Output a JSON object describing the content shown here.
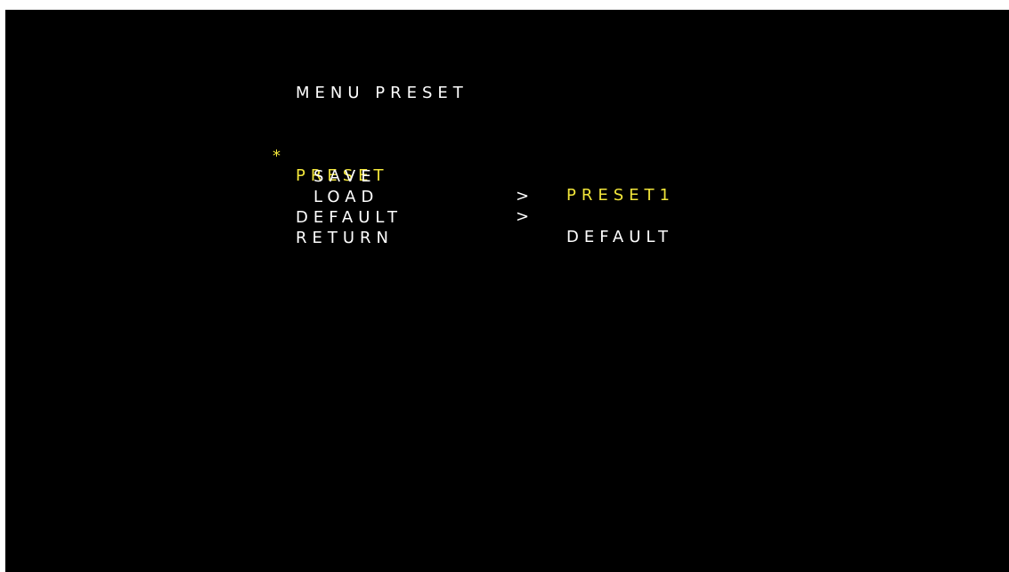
{
  "osd_menu": {
    "title": "MENU PRESET",
    "selection_marker": "*",
    "highlight_color": "#f2e63a",
    "text_color": "#ffffff",
    "background_color": "#000000",
    "items": [
      {
        "label": "PRESET",
        "arrow": "",
        "value": "PRESET1",
        "selected": true
      },
      {
        "label": "SAVE",
        "arrow": ">",
        "value": "",
        "selected": false
      },
      {
        "label": "LOAD",
        "arrow": ">",
        "value": "",
        "selected": false
      },
      {
        "label": "DEFAULT",
        "arrow": "",
        "value": "DEFAULT",
        "selected": false
      },
      {
        "label": "RETURN",
        "arrow": "",
        "value": "",
        "selected": false
      }
    ]
  }
}
